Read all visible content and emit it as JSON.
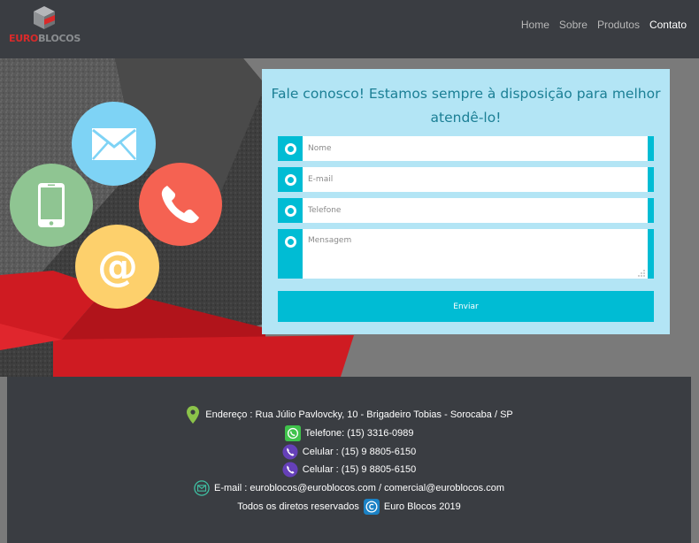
{
  "brand": {
    "logo_part1": "EURO",
    "logo_part2": "BLOCOS"
  },
  "nav": {
    "items": [
      "Home",
      "Sobre",
      "Produtos",
      "Contato"
    ],
    "active": "Contato"
  },
  "contact_form": {
    "heading": "Fale conosco! Estamos sempre à disposição para melhor atendê-lo!",
    "name_placeholder": "Nome",
    "email_placeholder": "E-mail",
    "phone_placeholder": "Telefone",
    "message_placeholder": "Mensagem",
    "submit_label": "Enviar"
  },
  "footer": {
    "address": "Endereço : Rua Júlio Pavlovcky, 10 - Brigadeiro Tobias - Sorocaba / SP",
    "phone": "Telefone: (15) 3316-0989",
    "cell_1": "Celular : (15) 9 8805-6150",
    "cell_2": "Celular : (15) 9 8805-6150",
    "email": "E-mail : euroblocos@euroblocos.com / comercial@euroblocos.com",
    "rights": "Todos os diretos reservados",
    "copyright": "Euro Blocos 2019"
  },
  "icons": {
    "hero": [
      "envelope-icon",
      "smartphone-icon",
      "phone-icon",
      "at-sign-icon"
    ],
    "footer": [
      "location-pin-icon",
      "whatsapp-icon",
      "viber-icon",
      "viber-icon",
      "email-icon",
      "copyright-icon"
    ]
  },
  "colors": {
    "header_bg": "#3a3d42",
    "accent": "#00bcd4",
    "form_bg": "#b3e5f5",
    "heading_text": "#1b7f95",
    "logo_red": "#d92a2a",
    "hero_red": "#d41a22"
  }
}
